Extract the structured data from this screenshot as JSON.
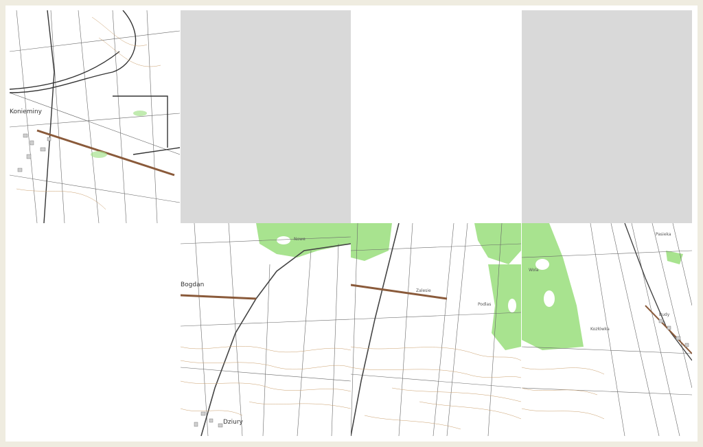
{
  "map": {
    "place_labels": {
      "konieminy": "Konieminy",
      "bogdan": "Bogdan",
      "dziury": "Dziury",
      "nowe": "Nowe",
      "kozlowka": "Kozłówka",
      "zalesie": "Zalesie",
      "podlas": "Podlas",
      "pasieka": "Pasieka",
      "budy": "Budy",
      "wola": "Wola"
    },
    "colors": {
      "forest": "#a8e38f",
      "forest_dark": "#7fd06a",
      "contour": "#c99d6a",
      "road": "#555555",
      "tile_loading": "#d9d9d9",
      "background": "#efece0"
    },
    "tiles": [
      {
        "state": "loaded"
      },
      {
        "state": "loading"
      },
      {
        "state": "empty"
      },
      {
        "state": "loading"
      },
      {
        "state": "empty"
      },
      {
        "state": "loaded"
      },
      {
        "state": "loaded"
      },
      {
        "state": "loaded"
      }
    ]
  }
}
